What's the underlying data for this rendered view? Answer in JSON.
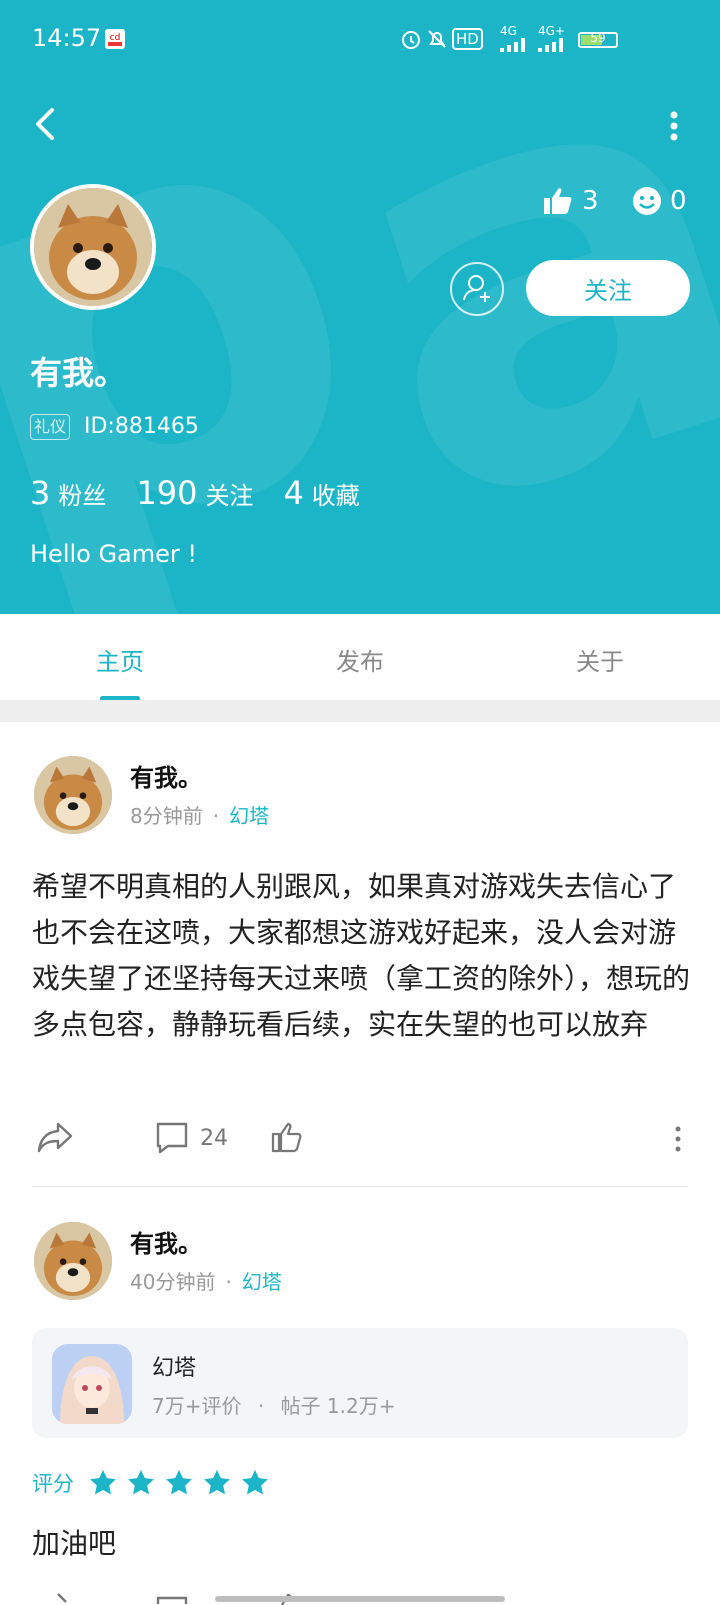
{
  "status_bar": {
    "time": "14:57",
    "hd_label": "HD",
    "net1": "4G",
    "net2": "4G+",
    "battery": "59"
  },
  "profile": {
    "nickname": "有我。",
    "badge": "礼仪",
    "user_id": "ID:881465",
    "likes": "3",
    "smiles": "0",
    "follow_label": "关注",
    "bio": "Hello Gamer !",
    "stats": [
      {
        "value": "3",
        "label": "粉丝"
      },
      {
        "value": "190",
        "label": "关注"
      },
      {
        "value": "4",
        "label": "收藏"
      }
    ]
  },
  "tabs": [
    {
      "label": "主页"
    },
    {
      "label": "发布"
    },
    {
      "label": "关于"
    }
  ],
  "posts": [
    {
      "author": "有我。",
      "time": "8分钟前",
      "dot": "·",
      "game": "幻塔",
      "text": "希望不明真相的人别跟风，如果真对游戏失去信心了也不会在这喷，大家都想这游戏好起来，没人会对游戏失望了还坚持每天过来喷（拿工资的除外），想玩的多点包容，静静玩看后续，实在失望的也可以放弃",
      "comments": "24"
    },
    {
      "author": "有我。",
      "time": "40分钟前",
      "dot": "·",
      "game": "幻塔",
      "game_card": {
        "name": "幻塔",
        "reviews": "7万+评价",
        "dot": "·",
        "posts": "帖子 1.2万+"
      },
      "rating_label": "评分",
      "rating_stars": 5,
      "text": "加油吧"
    }
  ],
  "colors": {
    "accent": "#1cb5c7",
    "header_bg": "#1cb5c7"
  }
}
